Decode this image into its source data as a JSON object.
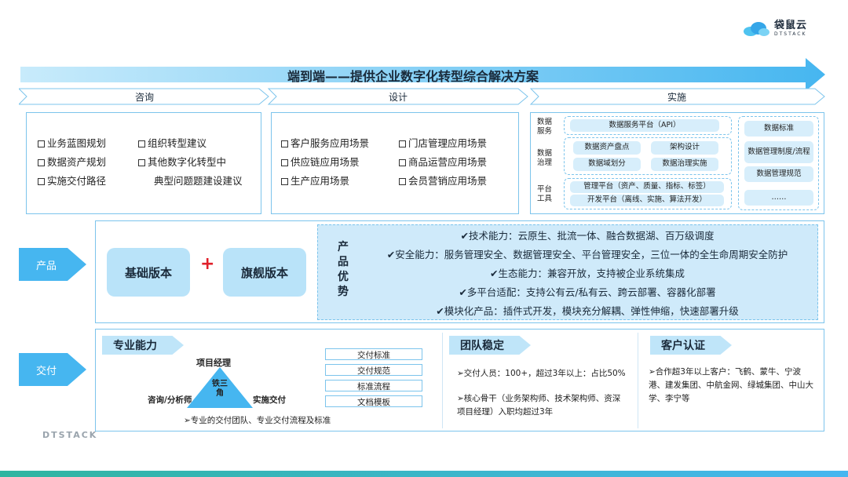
{
  "brand": {
    "name": "袋鼠云",
    "sub": "DTSTACK",
    "footer": "DTSTACK"
  },
  "title": "端到端——提供企业数字化转型综合解决方案",
  "phases": [
    "咨询",
    "设计",
    "实施"
  ],
  "consult": {
    "col1": [
      "业务蓝图规划",
      "数据资产规划",
      "实施交付路径"
    ],
    "col2": [
      "组织转型建议",
      "其他数字化转型中",
      "典型问题题建设建议"
    ]
  },
  "design": {
    "col1": [
      "客户服务应用场景",
      "供应链应用场景",
      "生产应用场景"
    ],
    "col2": [
      "门店管理应用场景",
      "商品运营应用场景",
      "会员营销应用场景"
    ]
  },
  "impl": {
    "cat_service": "数据\n服务",
    "cat_gov": "数据\n治理",
    "cat_tool": "平台\n工具",
    "service_platform": "数据服务平台（API）",
    "gov_items": [
      "数据资产盘点",
      "架构设计",
      "数据域划分",
      "数据治理实施"
    ],
    "tool_items": [
      "管理平台（资产、质量、指标、标签）",
      "开发平台（离线、实施、算法开发）"
    ],
    "right_items": [
      "数据标准",
      "数据管理制度/流程",
      "数据管理规范",
      "……"
    ]
  },
  "product": {
    "label": "产品",
    "basic": "基础版本",
    "plus": "+",
    "flagship": "旗舰版本",
    "adv_title": "产品优势",
    "advantages": [
      "✔技术能力：云原生、批流一体、融合数据湖、百万级调度",
      "✔安全能力：服务管理安全、数据管理安全、平台管理安全，三位一体的全生命周期安全防护",
      "✔生态能力：兼容开放，支持被企业系统集成",
      "✔多平台适配：支持公有云/私有云、跨云部署、容器化部署",
      "✔模块化产品：插件式开发，模块充分解耦、弹性伸缩，快速部署升级"
    ]
  },
  "delivery": {
    "label": "交付",
    "pro": {
      "tag": "专业能力",
      "top": "项目经理",
      "center": "铁三\n角",
      "left": "咨询/分析师",
      "right": "实施交付",
      "docs": [
        "交付标准",
        "交付规范",
        "标准流程",
        "文档模板"
      ],
      "desc": "➢专业的交付团队、专业交付流程及标准"
    },
    "team": {
      "tag": "团队稳定",
      "p1": "➢交付人员：100+，超过3年以上：占比50%",
      "p2": "➢核心骨干（业务架构师、技术架构师、资深项目经理）入职均超过3年"
    },
    "client": {
      "tag": "客户认证",
      "p1": "➢合作超3年以上客户：飞鹤、蒙牛、宁波港、建发集团、中航金网、绿城集团、中山大学、李宁等"
    }
  },
  "colors": {
    "accent": "#46b6f0",
    "light": "#d7eefb",
    "border": "#7cc4ec"
  }
}
